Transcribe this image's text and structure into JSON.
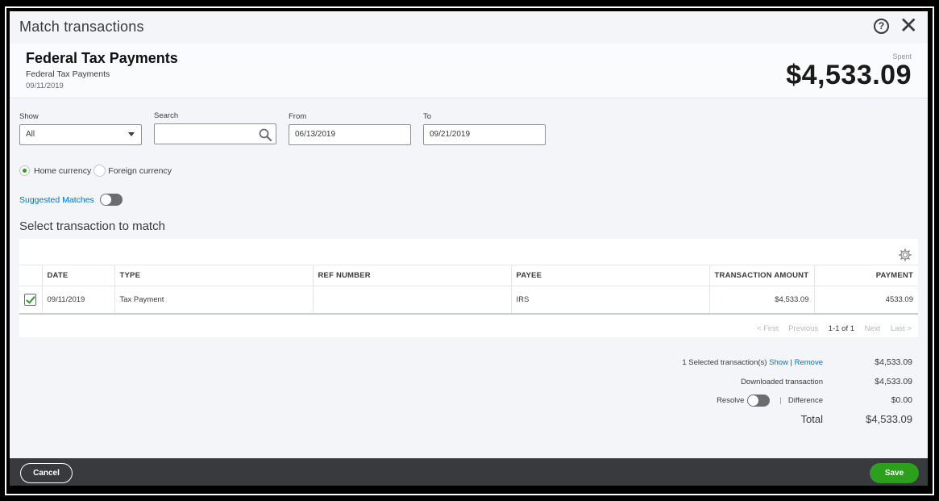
{
  "dialog": {
    "title": "Match transactions",
    "help_glyph": "?",
    "close_glyph": "✕"
  },
  "hero": {
    "name": "Federal Tax Payments",
    "subtitle": "Federal Tax Payments",
    "date": "09/11/2019",
    "spent_label": "Spent",
    "amount": "$4,533.09"
  },
  "filters": {
    "show_label": "Show",
    "show_value": "All",
    "search_label": "Search",
    "search_value": "",
    "from_label": "From",
    "from_value": "06/13/2019",
    "to_label": "To",
    "to_value": "09/21/2019"
  },
  "currency": {
    "home": "Home currency",
    "foreign": "Foreign currency",
    "selected": "home"
  },
  "suggested_matches": {
    "label": "Suggested Matches",
    "enabled": false
  },
  "section_title": "Select transaction to match",
  "table": {
    "columns": [
      "DATE",
      "TYPE",
      "REF NUMBER",
      "PAYEE",
      "TRANSACTION AMOUNT",
      "PAYMENT"
    ],
    "rows": [
      {
        "checked": true,
        "date": "09/11/2019",
        "type": "Tax Payment",
        "ref": "",
        "payee": "IRS",
        "amount": "$4,533.09",
        "payment": "4533.09"
      }
    ]
  },
  "pager": {
    "first": "< First",
    "previous": "Previous",
    "range": "1-1 of 1",
    "next": "Next",
    "last": "Last >"
  },
  "summary": {
    "selected_label": "1 Selected transaction(s)",
    "show_link": "Show",
    "separator": "|",
    "remove_link": "Remove",
    "selected_value": "$4,533.09",
    "downloaded_label": "Downloaded transaction",
    "downloaded_value": "$4,533.09",
    "resolve_label": "Resolve",
    "difference_label": "Difference",
    "difference_value": "$0.00",
    "total_label": "Total",
    "total_value": "$4,533.09"
  },
  "footer": {
    "cancel_label": "Cancel",
    "save_label": "Save"
  },
  "colors": {
    "accent_green": "#2ca01c",
    "link_blue": "#0077c5",
    "footer_bg": "#393a3d"
  }
}
